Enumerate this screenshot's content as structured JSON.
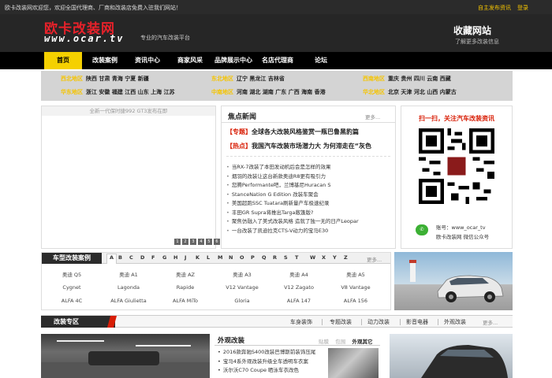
{
  "topbar": {
    "welcome": "欧卡改装网欢迎您，欢迎全国代理商、厂商和改装店免费入驻我们网站！",
    "publish": "自主发布资讯",
    "login": "登录"
  },
  "header": {
    "logo_cn": "欧卡改装网",
    "logo_en": "www.ocar.tv",
    "slogan": "专业的汽车改装平台",
    "favorite_title": "收藏网站",
    "favorite_sub": "了解更多改装信息"
  },
  "nav": [
    "首页",
    "改装案例",
    "资讯中心",
    "商家风采",
    "品牌展示中心",
    "名店代理商",
    "论坛"
  ],
  "regions": [
    {
      "name": "西北地区",
      "cities": "陕西 甘肃 青海 宁夏 新疆"
    },
    {
      "name": "东北地区",
      "cities": "辽宁 黑龙江 吉林省"
    },
    {
      "name": "西南地区",
      "cities": "重庆 贵州 四川 云南 西藏"
    },
    {
      "name": "华东地区",
      "cities": "浙江 安徽 福建 江西 山东 上海 江苏"
    },
    {
      "name": "中南地区",
      "cities": "河南 湖北 湖南 广东 广西 海南 香港"
    },
    {
      "name": "华北地区",
      "cities": "北京 天津 河北 山西 内蒙古"
    }
  ],
  "slideshow": {
    "caption": "全新一代保时捷992 GT3发布在即",
    "dots": [
      "1",
      "2",
      "3",
      "4",
      "5",
      "6"
    ]
  },
  "news": {
    "title": "焦点新闻",
    "more": "更多...",
    "headlines": [
      {
        "tag": "【专题】",
        "text": "全球各大改装风格鉴赏一瓶巴鲁黑豹篇"
      },
      {
        "tag": "【热点】",
        "text": "我国汽车改装市场潜力大 为何滞走在“灰色"
      }
    ],
    "items": [
      "当RX-7改装了本田发动机后会是怎样的效果",
      "烟羽的改装让这台新款奥迪R8更有吸引力",
      "您腾Performante吧，兰博基尼Huracan S",
      "StanceNation G Edition 改装车聚会",
      "美国超跑SSC Tuatara刷新量产车极速纪录",
      "丰田GR Supra将推出Targa敞篷版?",
      "聚焦仿融入了美式改装风格 造就了独一无的日产Leopar",
      "一台改装了凯迪拉克CTS-V动力的宝马E30"
    ]
  },
  "qr": {
    "title": "扫一扫，关注汽车改装资讯",
    "account": "账号：www_ocar_tv",
    "account_desc": "欧卡改装网 微信公众号"
  },
  "cases": {
    "label": "车型改装案例",
    "letters": [
      "A",
      "B",
      "C",
      "D",
      "F",
      "G",
      "H",
      "J",
      "K",
      "L",
      "M",
      "N",
      "O",
      "P",
      "Q",
      "R",
      "S",
      "T",
      "W",
      "X",
      "Y",
      "Z"
    ],
    "more": "更多...",
    "models": [
      [
        "奥迪 Q5",
        "奥迪 A1",
        "奥迪 AZ",
        "奥迪 A3",
        "奥迪 A4",
        "奥迪 A5"
      ],
      [
        "Cygnet",
        "Lagonda",
        "Rapide",
        "V12 Vantage",
        "V12 Zagato",
        "V8 Vantage"
      ],
      [
        "ALFA 4C",
        "ALFA Giulietta",
        "ALFA MiTo",
        "Gloria",
        "ALFA 147",
        "ALFA 156"
      ]
    ]
  },
  "zone": {
    "label": "改装专区",
    "links": [
      "车身装饰",
      "专题改装",
      "动力改装",
      "影音电器",
      "外观改装"
    ],
    "more": "更多..."
  },
  "exterior": {
    "title": "外观改装",
    "tabs": [
      "贴膜",
      "包围",
      "外观其它"
    ],
    "items": [
      "2016款奔驰S400改装巴博斯前装饰压尾",
      "宝马4系外观改装升级全车透明车衣案",
      "沃尔沃C70 Coupe 晒泳车衣改色"
    ]
  }
}
